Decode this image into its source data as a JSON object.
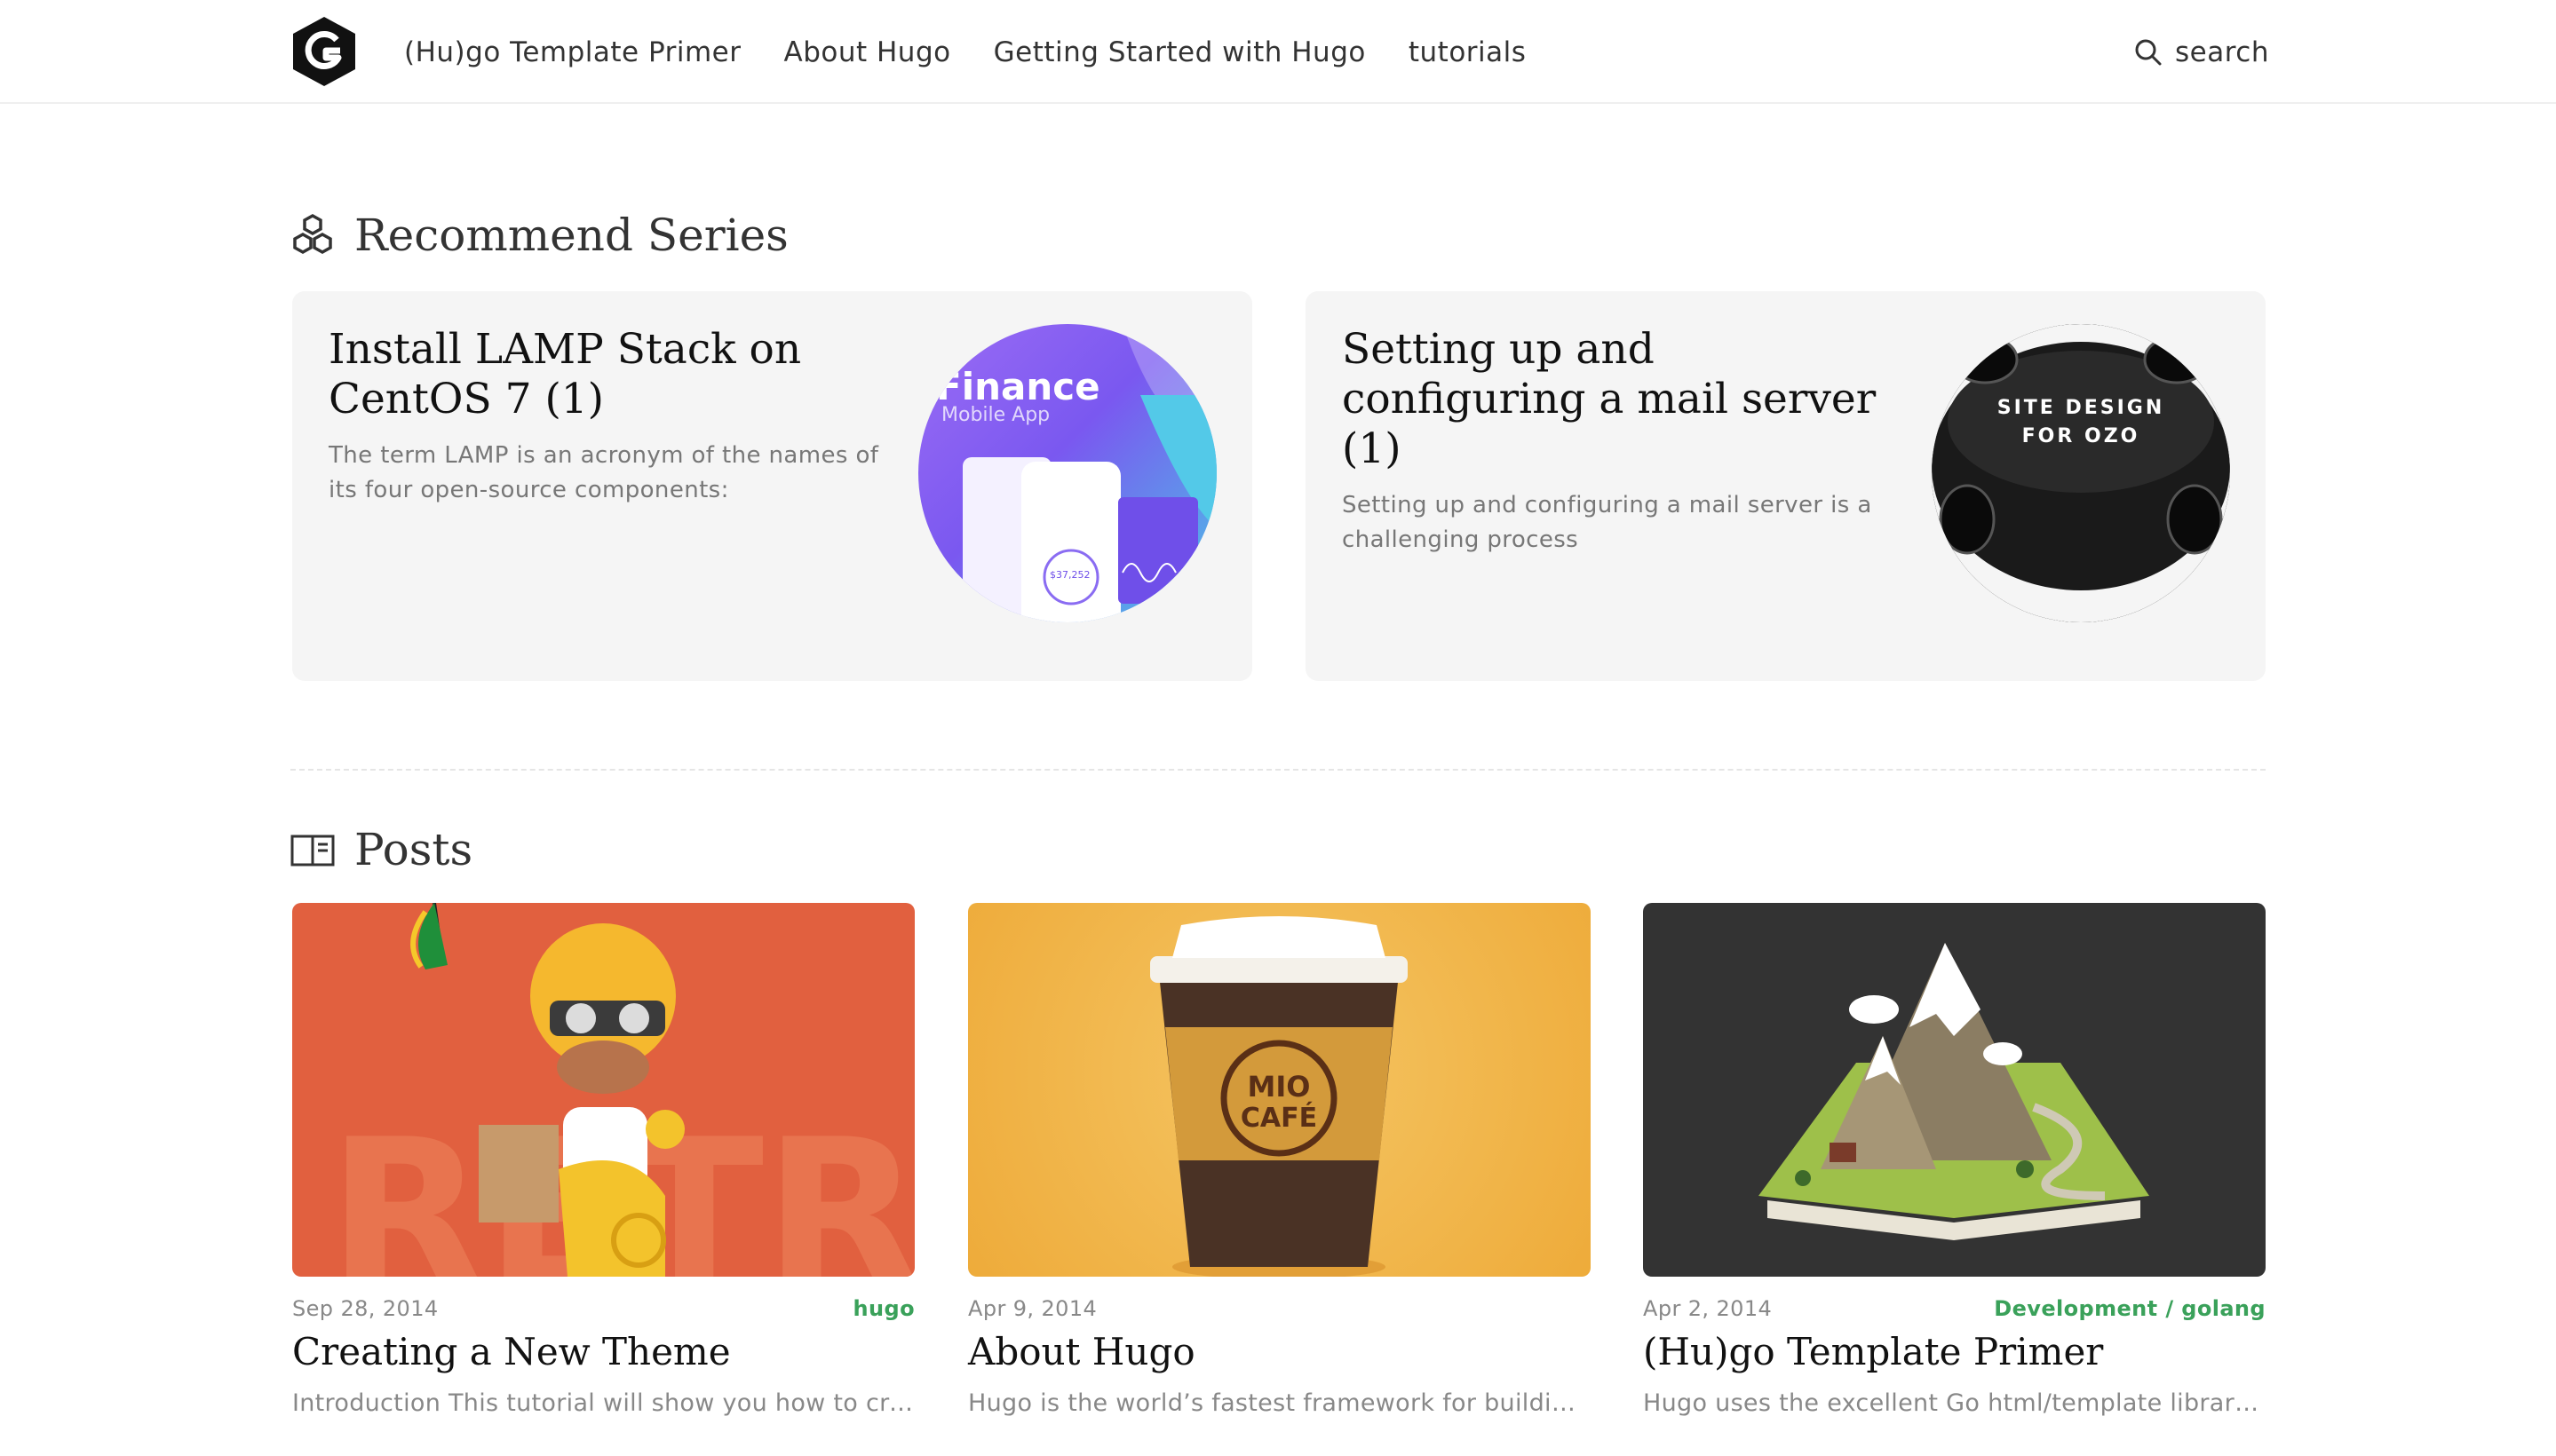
{
  "header": {
    "logo_icon": "hexagon-g-logo",
    "nav": [
      {
        "label": "(Hu)go Template Primer"
      },
      {
        "label": "About Hugo"
      },
      {
        "label": "Getting Started with Hugo"
      },
      {
        "label": "tutorials"
      }
    ],
    "search": {
      "label": "search",
      "icon": "search-icon"
    }
  },
  "series": {
    "title": "Recommend Series",
    "icon": "hexagons-icon",
    "items": [
      {
        "title": "Install LAMP Stack on CentOS 7 (1)",
        "summary": "The term LAMP is an acronym of the names of its four open-source components:",
        "thumb_text": "Finance",
        "thumb_subtext": "Mobile App",
        "thumb_amount": "$37,252"
      },
      {
        "title": "Setting up and configuring a mail server (1)",
        "summary": "Setting up and configuring a mail server is a challenging process",
        "thumb_text": "SITE DESIGN",
        "thumb_subtext": "FOR OZO"
      }
    ]
  },
  "posts": {
    "title": "Posts",
    "icon": "open-book-icon",
    "items": [
      {
        "date": "Sep 28, 2014",
        "tags": [
          "hugo"
        ],
        "title": "Creating a New Theme",
        "summary": "Introduction This tutorial will show you how to create a simple theme for Hugo.",
        "image": "scooter-rider-illustration",
        "image_text": "RETRI",
        "bg": "#e1603f"
      },
      {
        "date": "Apr 9, 2014",
        "tags": [],
        "title": "About Hugo",
        "summary": "Hugo is the world’s fastest framework for building websites.",
        "image": "coffee-cup-illustration",
        "image_text": "MIO CAFÉ",
        "bg": "#f1b343"
      },
      {
        "date": "Apr 2, 2014",
        "tags": [
          "Development",
          "golang"
        ],
        "title": "(Hu)go Template Primer",
        "summary": "Hugo uses the excellent Go html/template library for its template engine.",
        "image": "popup-book-mountain-illustration",
        "bg": "#333333"
      }
    ]
  },
  "colors": {
    "tag": "#3aa15a",
    "card_bg": "#f5f5f5"
  }
}
